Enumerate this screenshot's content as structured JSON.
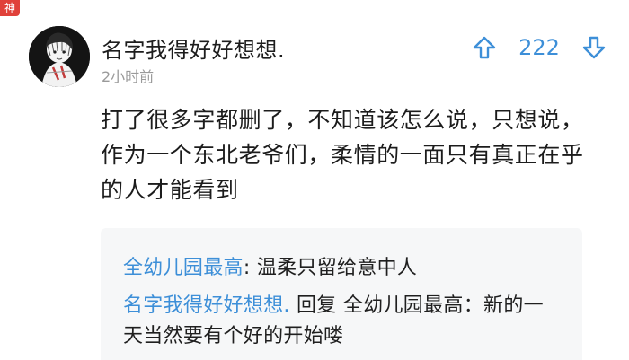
{
  "badge": {
    "label": "神"
  },
  "comment": {
    "avatar_icon": "avatar-portrait-icon",
    "username": "名字我得好好想想.",
    "time": "2小时前",
    "vote_count": "222",
    "upvote_icon": "arrow-up-icon",
    "downvote_icon": "arrow-down-icon",
    "text": "打了很多字都删了，不知道该怎么说，只想说，作为一个东北老爷们，柔情的一面只有真正在乎的人才能看到"
  },
  "replies": [
    {
      "author": "全幼儿园最高",
      "separator": ": ",
      "text": "温柔只留给意中人"
    },
    {
      "author": "名字我得好好想想.",
      "reply_word": " 回复 ",
      "target": "全幼儿园最高",
      "separator": "：",
      "text": "新的一天当然要有个好的开始喽"
    }
  ],
  "colors": {
    "accent": "#3d8fd8",
    "muted": "#9a9a9a",
    "reply_bg": "#f6f7f8",
    "badge": "#e0413a"
  }
}
